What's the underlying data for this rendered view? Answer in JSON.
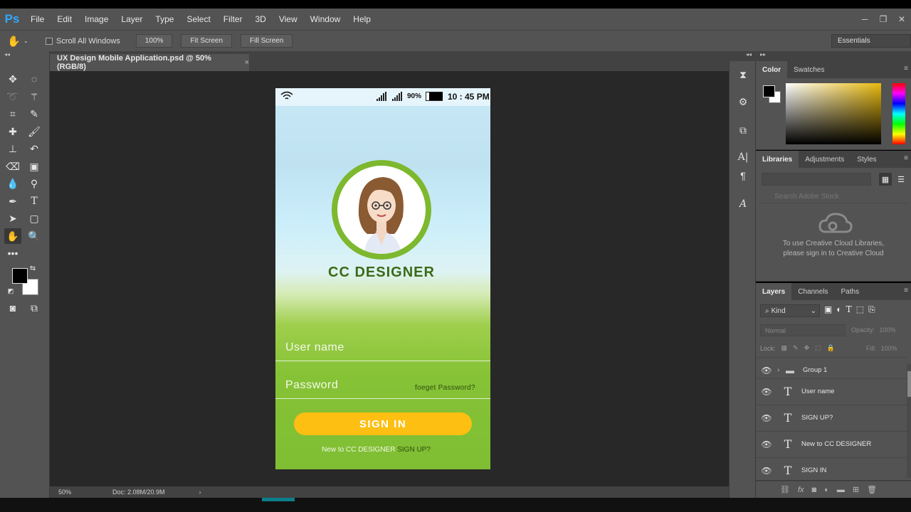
{
  "app": {
    "logo": "Ps",
    "menu": [
      "File",
      "Edit",
      "Image",
      "Layer",
      "Type",
      "Select",
      "Filter",
      "3D",
      "View",
      "Window",
      "Help"
    ],
    "window_controls": [
      "─",
      "❐",
      "✕"
    ]
  },
  "options_bar": {
    "scroll_all_windows": "Scroll All Windows",
    "zoom_value": "100%",
    "fit_screen": "Fit Screen",
    "fill_screen": "Fill Screen",
    "workspace": "Essentials"
  },
  "document": {
    "tab_title": "UX Design Mobile Application.psd @ 50% (RGB/8)",
    "tab_close": "×",
    "status_zoom": "50%",
    "status_doc": "Doc: 2.08M/20.9M"
  },
  "phone": {
    "battery": "90%",
    "time": "10 : 45 PM",
    "title": "CC DESIGNER",
    "username_placeholder": "User name",
    "password_placeholder": "Password",
    "forgot": "foeget Password?",
    "signin": "SIGN IN",
    "new_to": "New to CC DESIGNER",
    "signup": "SIGN UP?"
  },
  "panels": {
    "color_tabs": [
      "Color",
      "Swatches"
    ],
    "library_tabs": [
      "Libraries",
      "Adjustments",
      "Styles"
    ],
    "library_search_placeholder": "Search Adobe Stock",
    "library_message_line1": "To use Creative Cloud Libraries,",
    "library_message_line2": "please sign in to Creative Cloud",
    "layer_tabs": [
      "Layers",
      "Channels",
      "Paths"
    ],
    "kind": "Kind",
    "blend_mode": "Normal",
    "opacity_label": "Opacity:",
    "opacity_value": "100%",
    "lock_label": "Lock:",
    "fill_label": "Fill:",
    "fill_value": "100%",
    "layers": [
      {
        "name": "Group 1",
        "type": "group"
      },
      {
        "name": "User name",
        "type": "text"
      },
      {
        "name": "SIGN UP?",
        "type": "text"
      },
      {
        "name": "New to CC DESIGNER",
        "type": "text"
      },
      {
        "name": "SIGN IN",
        "type": "text"
      }
    ]
  },
  "colors": {
    "ps_blue": "#31a8ff",
    "brand_green": "#7db82e",
    "title_green": "#3b6a16",
    "signin_yellow": "#fdbf12"
  }
}
